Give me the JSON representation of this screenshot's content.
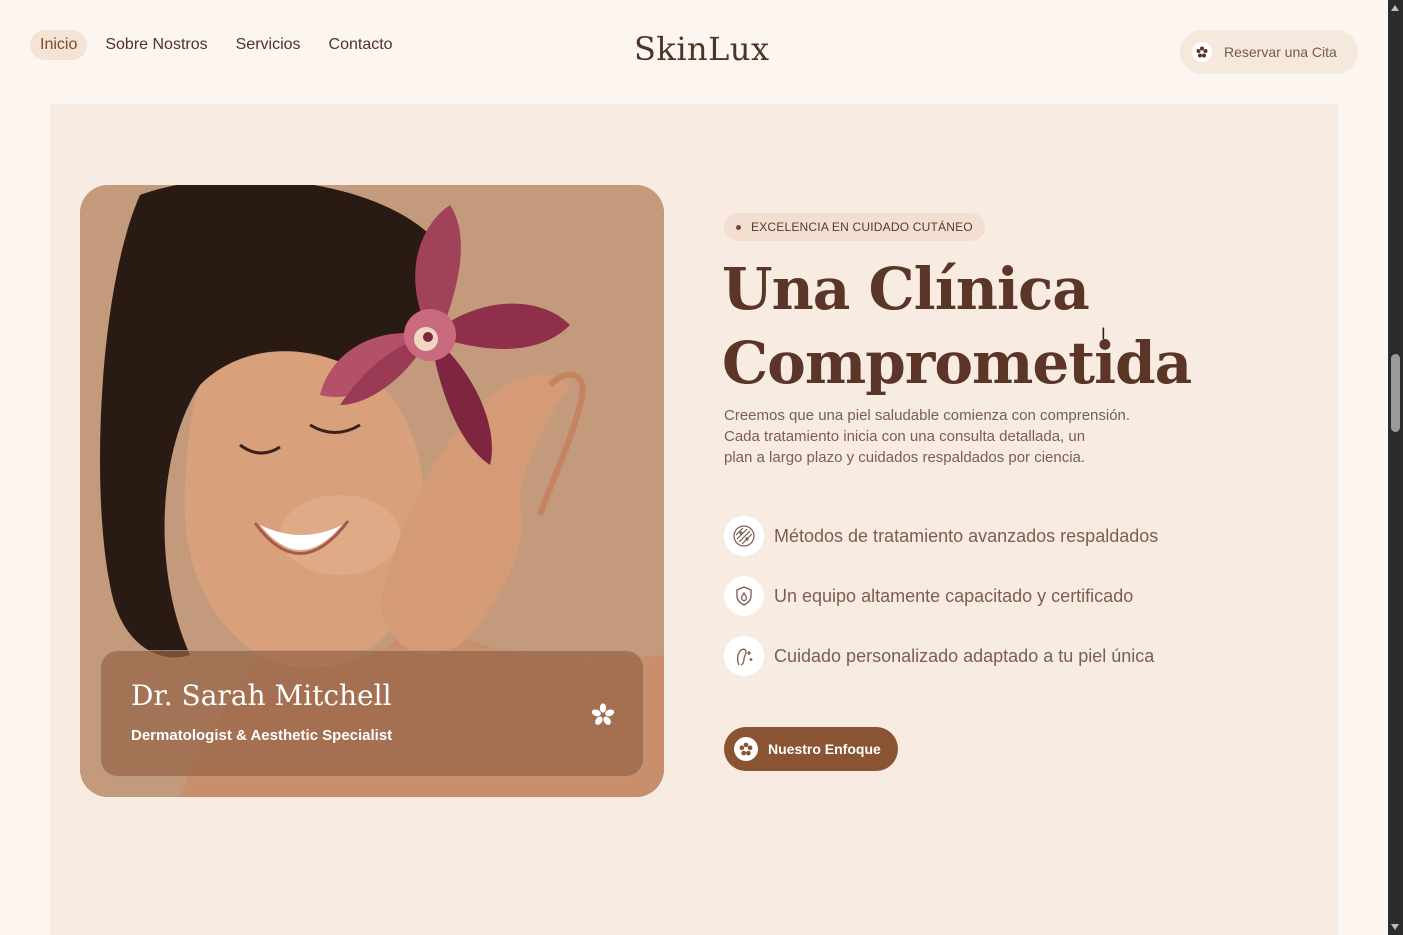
{
  "nav": {
    "items": [
      {
        "label": "Inicio",
        "active": true
      },
      {
        "label": "Sobre Nostros",
        "active": false
      },
      {
        "label": "Servicios",
        "active": false
      },
      {
        "label": "Contacto",
        "active": false
      }
    ]
  },
  "brand": {
    "logo": "SkinLux"
  },
  "header": {
    "cta_label": "Reservar una Cita",
    "cta_icon": "flower-icon"
  },
  "hero": {
    "badge": "EXCELENCIA EN CUIDADO CUTÁNEO",
    "headline_line1": "Una Clínica",
    "headline_line2": "Comprometida",
    "intro_line1": "Creemos que una piel saludable comienza con comprensión.",
    "intro_line2": "Cada tratamiento inicia con una consulta detallada, un",
    "intro_line3": "plan a largo plazo y cuidados respaldados por ciencia.",
    "features": [
      {
        "icon": "skin-texture-icon",
        "label": "Métodos de tratamiento avanzados respaldados"
      },
      {
        "icon": "shield-drop-icon",
        "label": "Un equipo altamente capacitado y certificado"
      },
      {
        "icon": "face-sparkle-icon",
        "label": "Cuidado personalizado adaptado a tu piel única"
      }
    ],
    "cta_label": "Nuestro Enfoque"
  },
  "doctor": {
    "name": "Dr. Sarah Mitchell",
    "role": "Dermatologist & Aesthetic Specialist",
    "icon": "flower-icon"
  },
  "colors": {
    "background": "#fdf5ef",
    "panel": "#f8ebe1",
    "accent": "#8a5432",
    "heading": "#5a3528",
    "body_text": "#7b5e50"
  }
}
